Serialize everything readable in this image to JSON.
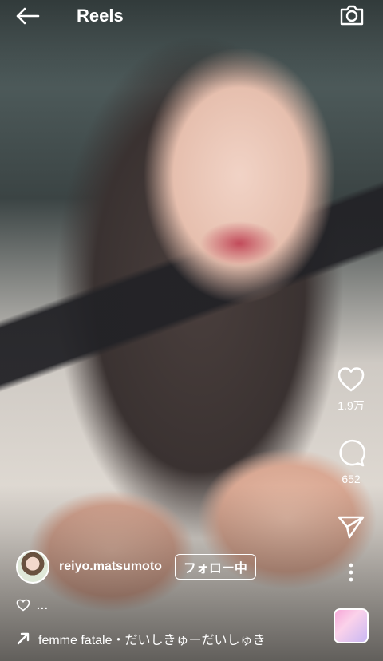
{
  "header": {
    "title": "Reels",
    "back_icon": "arrow-left-icon",
    "camera_icon": "camera-icon"
  },
  "actions": {
    "like_count": "1.9万",
    "comment_count": "652",
    "like_icon": "heart-icon",
    "comment_icon": "comment-bubble-icon",
    "share_icon": "send-icon",
    "more_icon": "more-vertical-icon"
  },
  "author": {
    "username": "reiyo.matsumoto",
    "follow_label": "フォロー中"
  },
  "caption": {
    "dots": "..."
  },
  "audio": {
    "text": "femme fatale・だいしきゅーだいしゅき"
  },
  "colors": {
    "text": "#ffffff"
  }
}
